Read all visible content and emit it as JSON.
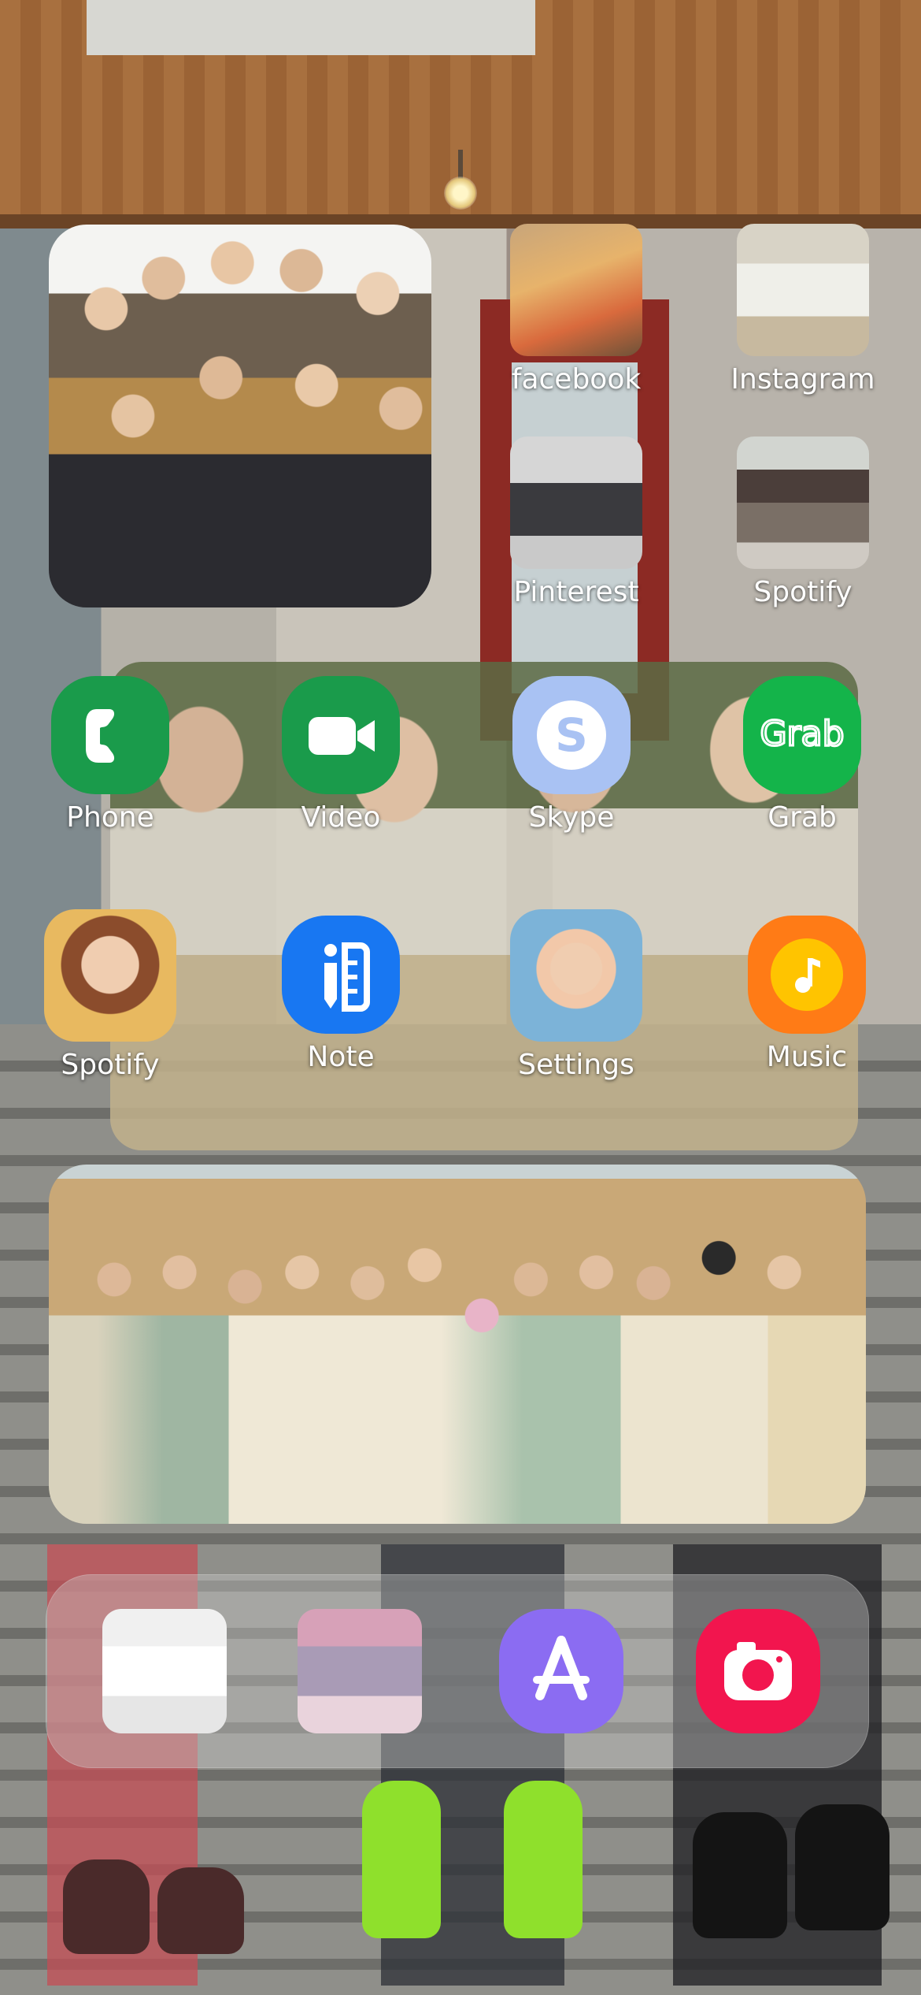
{
  "home_screen": {
    "row1_right": [
      {
        "label": "facebook"
      },
      {
        "label": "Instagram"
      }
    ],
    "row2_right": [
      {
        "label": "Pinterest"
      },
      {
        "label": "Spotify"
      }
    ],
    "row3": [
      {
        "label": "Phone",
        "icon": "phone-icon",
        "color": "#1a9b4b"
      },
      {
        "label": "Video",
        "icon": "video-camera-icon",
        "color": "#1a9b4b"
      },
      {
        "label": "Skype",
        "icon": "skype-icon",
        "color": "#a9c2f3"
      },
      {
        "label": "Grab",
        "icon": "grab-icon",
        "color": "#14b44a"
      }
    ],
    "row4": [
      {
        "label": "Spotify"
      },
      {
        "label": "Note",
        "icon": "note-icon",
        "color": "#1877f2"
      },
      {
        "label": "Settings"
      },
      {
        "label": "Music",
        "icon": "music-note-icon",
        "color": "#ff7b16"
      }
    ],
    "grab_logo_text": "Grab"
  },
  "dock": {
    "items": [
      {
        "icon": "photo-app"
      },
      {
        "icon": "photo-app"
      },
      {
        "icon": "app-store-icon",
        "color": "#8b6cf2"
      },
      {
        "icon": "camera-icon",
        "color": "#f2154e"
      }
    ]
  }
}
